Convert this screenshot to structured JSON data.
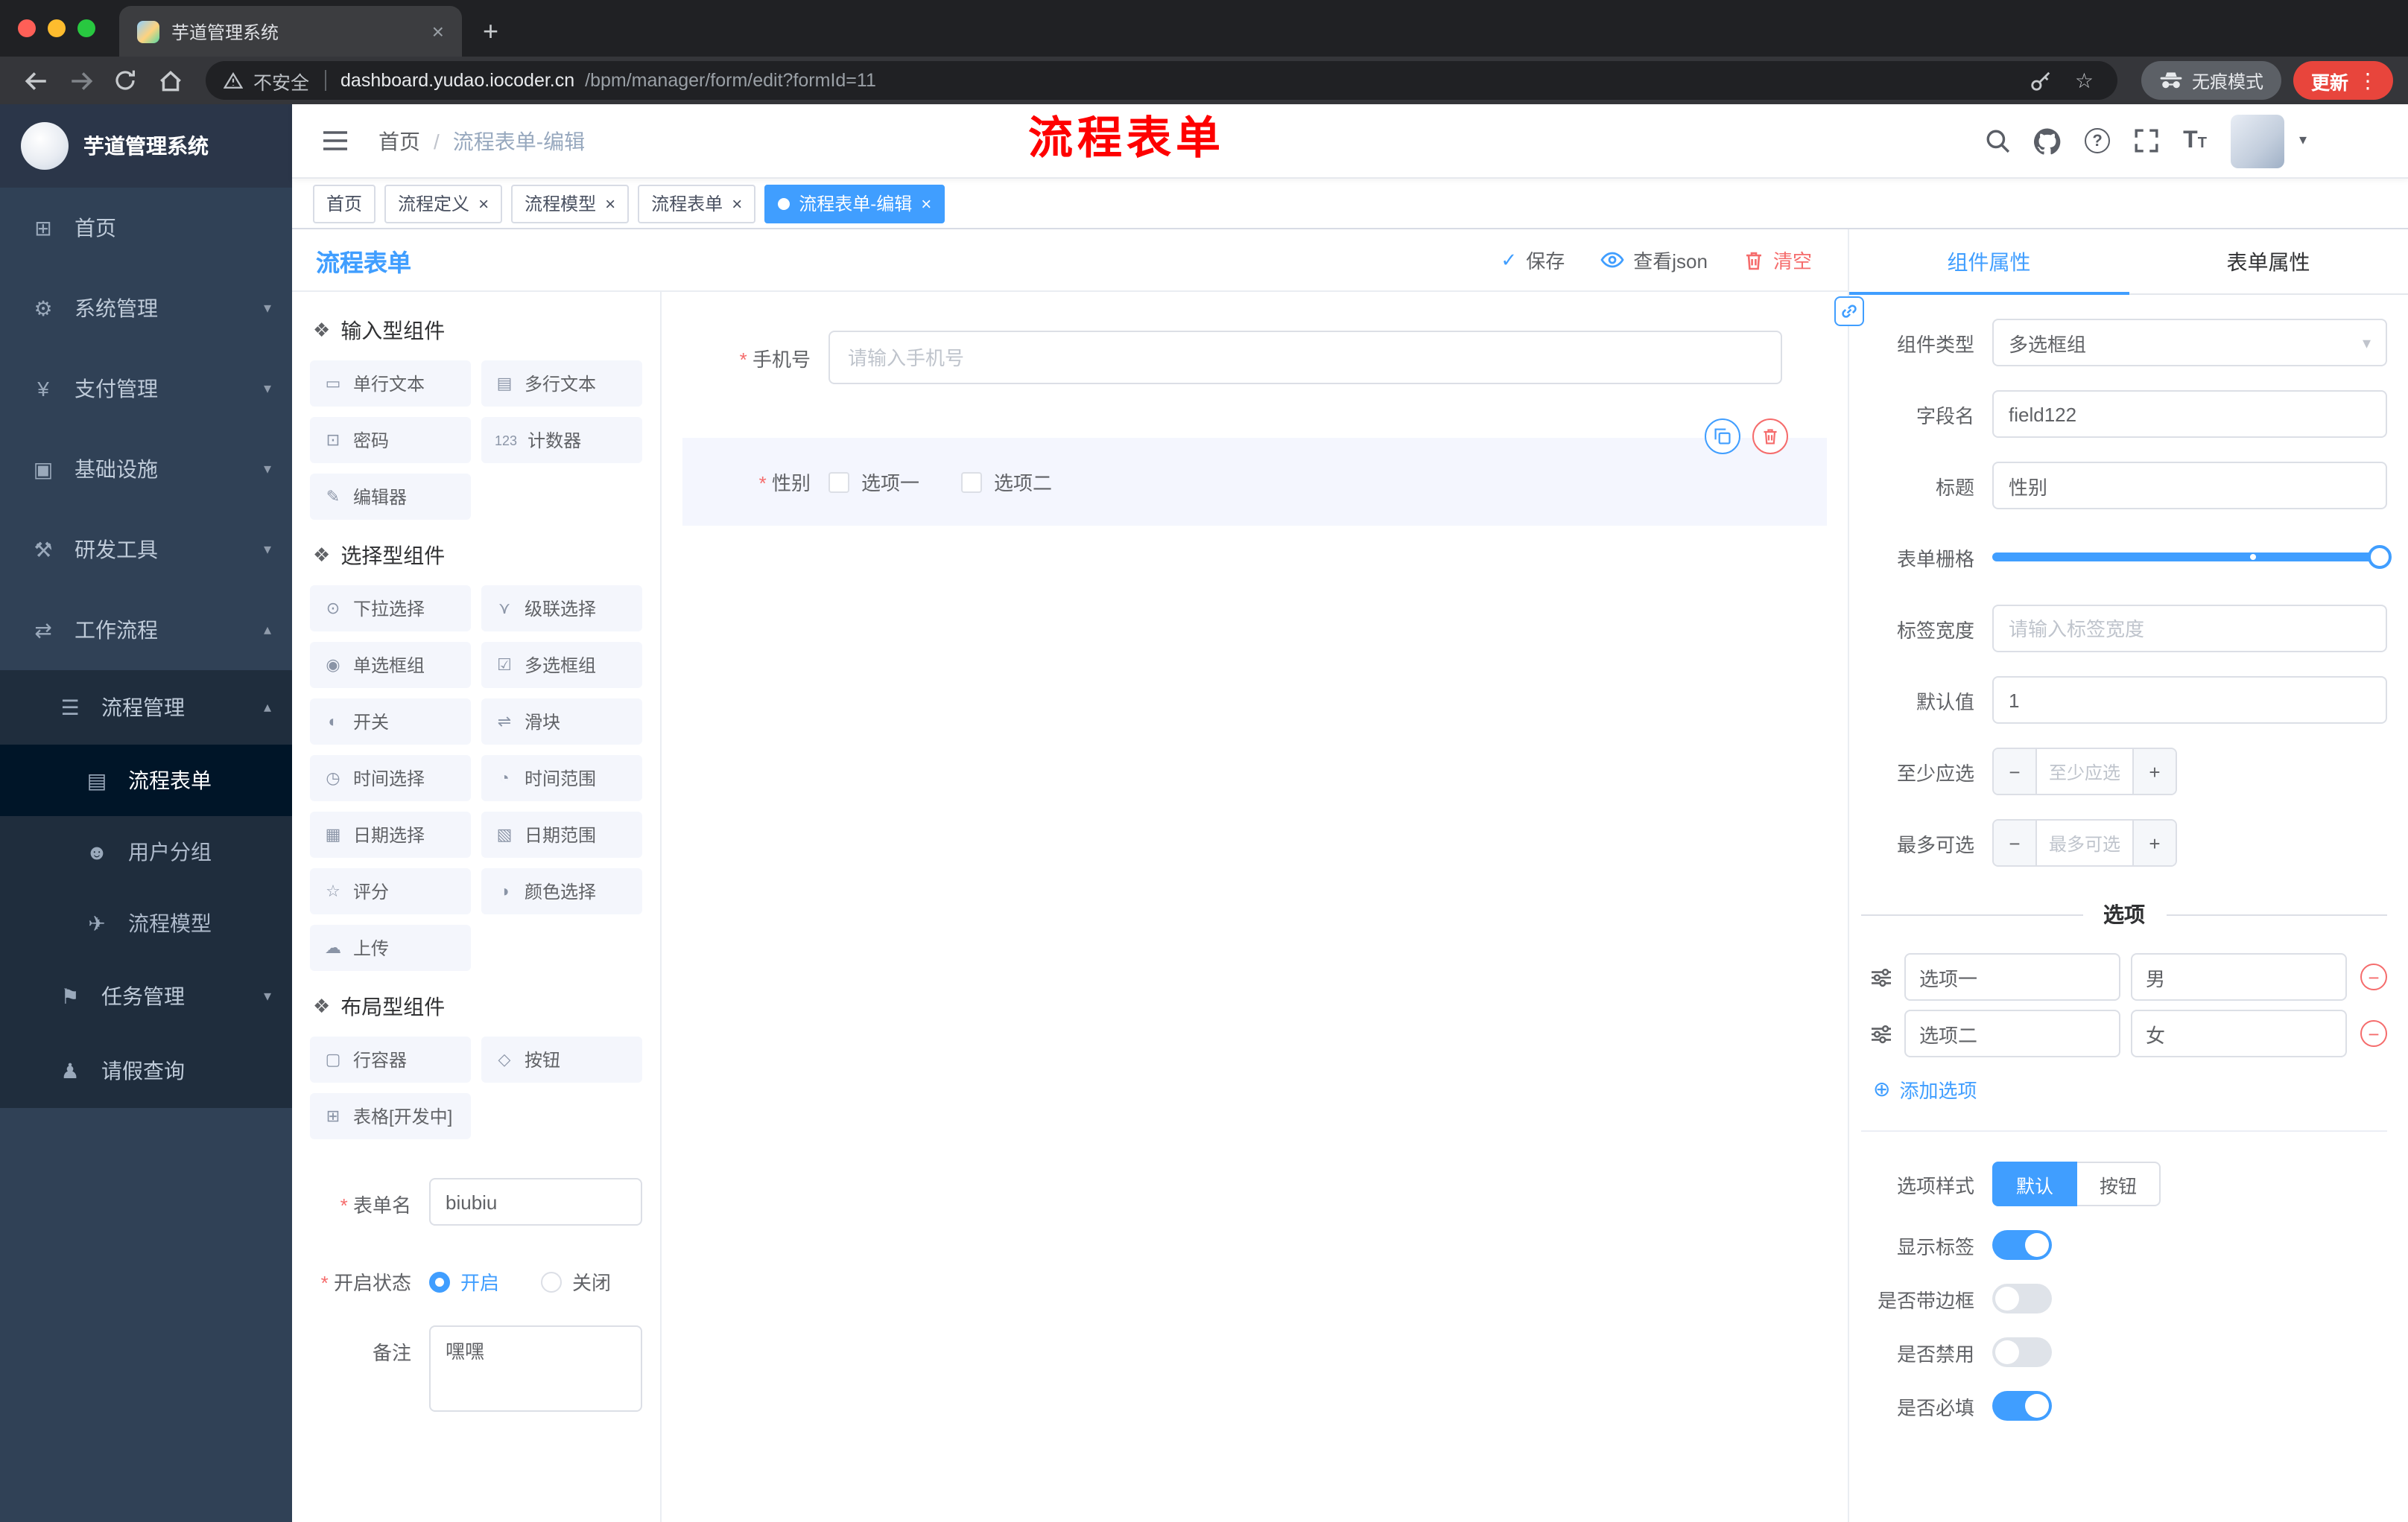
{
  "colors": {
    "accent": "#409EFF",
    "danger": "#F56C6C",
    "annotation_red": "#FE0000",
    "sidebar_bg": "#304156",
    "submenu_bg": "#1F2D3D",
    "active_item_bg": "#001528",
    "update_pill": "#E8453C"
  },
  "browser": {
    "tab_title": "芋道管理系统",
    "security_label": "不安全",
    "url_host": "dashboard.yudao.iocoder.cn",
    "url_path": "/bpm/manager/form/edit?formId=11",
    "incognito_label": "无痕模式",
    "update_label": "更新"
  },
  "icons": {
    "close": "×",
    "new_tab": "+",
    "star": "☆",
    "dots": "⋮",
    "menu_home": "⊞",
    "menu_system": "⚙",
    "menu_pay": "¥",
    "menu_infra": "▣",
    "menu_dev": "⚒",
    "menu_flow": "⇄",
    "menu_process": "☰",
    "menu_form": "▤",
    "menu_group": "☻",
    "menu_model": "✈",
    "menu_task": "⚑",
    "menu_leave": "♟",
    "chev_down": "▾",
    "chev_up": "▴",
    "crumb_sep": "/",
    "section": "❖",
    "c_single": "▭",
    "c_multi": "▤",
    "c_pwd": "⊡",
    "c_counter": "123",
    "c_editor": "✎",
    "c_select": "⊙",
    "c_cascade": "⋎",
    "c_radio": "◉",
    "c_check": "☑",
    "c_switch": "◐",
    "c_slider": "⇌",
    "c_time": "◷",
    "c_timerange": "◔",
    "c_date": "▦",
    "c_daterange": "▧",
    "c_rate": "☆",
    "c_color": "◑",
    "c_upload": "☁",
    "c_row": "▢",
    "c_btn": "◇",
    "c_table": "⊞",
    "check": "✓",
    "plus": "+",
    "minus": "−",
    "circle_plus": "⊕",
    "question": "?",
    "font_big": "T",
    "font_small": "T",
    "caret": "▾"
  },
  "sidebar": {
    "logo_title": "芋道管理系统",
    "menu": [
      {
        "label": "首页"
      },
      {
        "label": "系统管理"
      },
      {
        "label": "支付管理"
      },
      {
        "label": "基础设施"
      },
      {
        "label": "研发工具"
      },
      {
        "label": "工作流程"
      },
      {
        "label": "流程管理"
      },
      {
        "label": "流程表单"
      },
      {
        "label": "用户分组"
      },
      {
        "label": "流程模型"
      },
      {
        "label": "任务管理"
      },
      {
        "label": "请假查询"
      }
    ]
  },
  "navbar": {
    "breadcrumb_home": "首页",
    "breadcrumb_current": "流程表单-编辑",
    "annotation": "流程表单"
  },
  "tags": [
    {
      "label": "首页"
    },
    {
      "label": "流程定义"
    },
    {
      "label": "流程模型"
    },
    {
      "label": "流程表单"
    },
    {
      "label": "流程表单-编辑"
    }
  ],
  "designer": {
    "title": "流程表单",
    "save": "保存",
    "view_json": "查看json",
    "clear": "清空"
  },
  "components_panel": {
    "sections": [
      {
        "title": "输入型组件",
        "items": [
          "单行文本",
          "多行文本",
          "密码",
          "计数器",
          "编辑器"
        ]
      },
      {
        "title": "选择型组件",
        "items": [
          "下拉选择",
          "级联选择",
          "单选框组",
          "多选框组",
          "开关",
          "滑块",
          "时间选择",
          "时间范围",
          "日期选择",
          "日期范围",
          "评分",
          "颜色选择",
          "上传"
        ]
      },
      {
        "title": "布局型组件",
        "items": [
          "行容器",
          "按钮",
          "表格[开发中]"
        ]
      }
    ],
    "form": {
      "name_label": "表单名",
      "name_value": "biubiu",
      "status_label": "开启状态",
      "status_on": "开启",
      "status_off": "关闭",
      "remark_label": "备注",
      "remark_value": "嘿嘿"
    }
  },
  "canvas": {
    "phone": {
      "label": "手机号",
      "placeholder": "请输入手机号"
    },
    "gender": {
      "label": "性别",
      "option1": "选项一",
      "option2": "选项二"
    }
  },
  "properties_panel": {
    "tab_component": "组件属性",
    "tab_form": "表单属性",
    "component_type_label": "组件类型",
    "component_type_value": "多选框组",
    "field_name_label": "字段名",
    "field_name_value": "field122",
    "title_label": "标题",
    "title_value": "性别",
    "grid_label": "表单栅格",
    "label_width_label": "标签宽度",
    "label_width_placeholder": "请输入标签宽度",
    "default_label": "默认值",
    "default_value": "1",
    "min_label": "至少应选",
    "min_placeholder": "至少应选",
    "max_label": "最多可选",
    "max_placeholder": "最多可选",
    "options_title": "选项",
    "options": [
      {
        "label": "选项一",
        "value": "男"
      },
      {
        "label": "选项二",
        "value": "女"
      }
    ],
    "add_option": "添加选项",
    "style_label": "选项样式",
    "style_default": "默认",
    "style_button": "按钮",
    "switch_show_label": "显示标签",
    "switch_border": "是否带边框",
    "switch_disabled": "是否禁用",
    "switch_required": "是否必填"
  }
}
